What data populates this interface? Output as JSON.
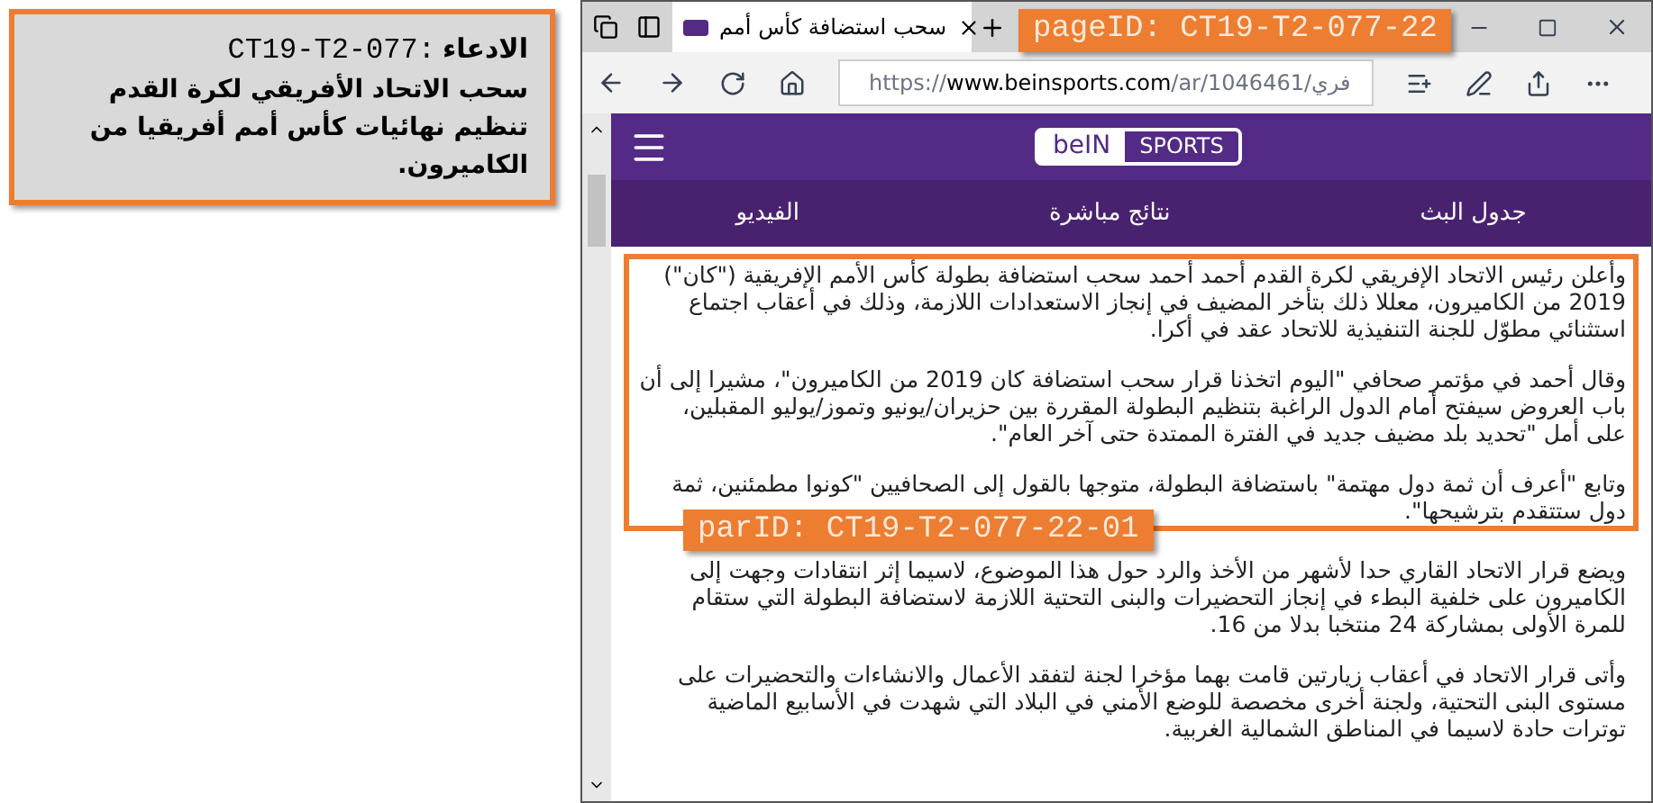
{
  "claim": {
    "label": "الادعاء",
    "id": "CT19-T2-077:",
    "text": "سحب الاتحاد الأفريقي لكرة القدم تنظيم نهائيات كأس أمم أفريقيا من الكاميرون."
  },
  "page_id_tag": "pageID: CT19-T2-077-22",
  "browser": {
    "tab": {
      "title": "سحب استضافة كأس أمم",
      "selected": true
    },
    "url": {
      "scheme": "https://",
      "host": "www.beinsports.com",
      "path": "/ar/1046461/فري"
    }
  },
  "site": {
    "logo": {
      "brand": "beIN",
      "label": "SPORTS"
    },
    "nav": [
      {
        "label": "جدول البث"
      },
      {
        "label": "نتائج مباشرة"
      },
      {
        "label": "الفيديو"
      }
    ]
  },
  "article": {
    "highlighted": [
      "وأعلن رئيس الاتحاد الإفريقي لكرة القدم أحمد أحمد سحب استضافة بطولة كأس الأمم الإفريقية (\"كان\") 2019 من الكاميرون، معللا ذلك بتأخر المضيف في إنجاز الاستعدادات اللازمة، وذلك في أعقاب اجتماع استثنائي مطوّل للجنة التنفيذية للاتحاد عقد في أكرا.",
      "وقال أحمد في مؤتمر صحافي \"اليوم اتخذنا قرار سحب استضافة كان 2019 من الكاميرون\"، مشيرا إلى أن باب العروض سيفتح أمام الدول الراغبة بتنظيم البطولة المقررة بين حزيران/يونيو وتموز/يوليو المقبلين، على أمل \"تحديد بلد مضيف جديد في الفترة الممتدة حتى آخر العام\".",
      "وتابع \"أعرف أن ثمة دول مهتمة\" باستضافة البطولة، متوجها بالقول إلى الصحافيين \"كونوا مطمئنين، ثمة دول ستتقدم بترشيحها\"."
    ],
    "rest": [
      "ويضع قرار الاتحاد القاري حدا لأشهر من الأخذ والرد حول هذا الموضوع، لاسيما إثر انتقادات وجهت إلى الكاميرون على خلفية البطء في إنجاز التحضيرات والبنى التحتية اللازمة لاستضافة البطولة التي ستقام للمرة الأولى بمشاركة 24 منتخبا بدلا من 16.",
      "وأتى قرار الاتحاد في أعقاب زيارتين قامت بهما مؤخرا لجنة لتفقد الأعمال والانشاءات والتحضيرات على مستوى البنى التحتية، ولجنة أخرى مخصصة للوضع الأمني في البلاد التي شهدت في الأسابيع الماضية توترات حادة لاسيما في المناطق الشمالية الغربية."
    ]
  },
  "par_id_tag": "parID: CT19-T2-077-22-01"
}
